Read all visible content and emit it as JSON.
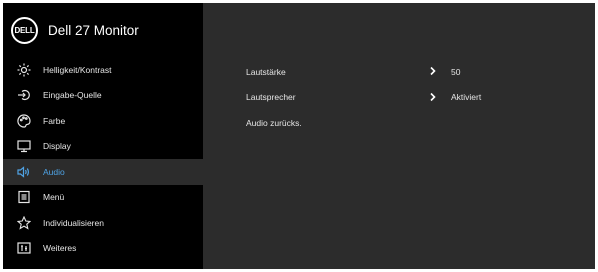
{
  "osd": {
    "logo_text": "DELL",
    "title": "Dell 27 Monitor"
  },
  "sidebar": {
    "items": [
      {
        "label": "Helligkeit/Kontrast",
        "icon": "brightness-icon"
      },
      {
        "label": "Eingabe-Quelle",
        "icon": "input-source-icon"
      },
      {
        "label": "Farbe",
        "icon": "palette-icon"
      },
      {
        "label": "Display",
        "icon": "monitor-icon"
      },
      {
        "label": "Audio",
        "icon": "speaker-icon",
        "active": true
      },
      {
        "label": "Menü",
        "icon": "menu-icon"
      },
      {
        "label": "Individualisieren",
        "icon": "star-icon"
      },
      {
        "label": "Weiteres",
        "icon": "info-icon"
      }
    ]
  },
  "audio": {
    "rows": [
      {
        "label": "Lautstärke",
        "value": "50"
      },
      {
        "label": "Lautsprecher",
        "value": "Aktiviert"
      },
      {
        "label": "Audio zurücks.",
        "value": ""
      }
    ]
  },
  "colors": {
    "sidebar_bg": "#000000",
    "panel_bg": "#2c2c2c",
    "accent": "#4fa3e5",
    "text": "#e6e6e6"
  }
}
